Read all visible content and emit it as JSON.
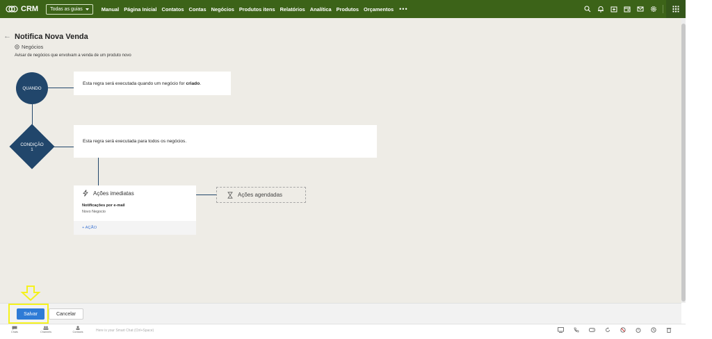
{
  "app": {
    "logo_text": "CRM",
    "guide_dropdown": "Todas as guias"
  },
  "nav": {
    "items": [
      "Manual",
      "Página Inicial",
      "Contatos",
      "Contas",
      "Negócios",
      "Produtos itens",
      "Relatórios",
      "Analítica",
      "Produtos",
      "Orçamentos"
    ],
    "more": "•••"
  },
  "rule": {
    "title": "Notifica Nova Venda",
    "module": "Negócios",
    "description": "Avisar de negócios que envolvam a venda de um produto novo"
  },
  "flow": {
    "when_label": "QUANDO",
    "when_text_pre": "Esta regra será executada quando um negócio for ",
    "when_text_bold": "criado",
    "when_text_post": ".",
    "condition_label": "CONDIÇÃO",
    "condition_number": "1",
    "condition_text": "Esta regra será executada para todos os negócios.",
    "immediate_title": "Ações imediatas",
    "immediate_item_title": "Notificações por e-mail",
    "immediate_item_sub": "Novo Negocio",
    "add_action": "+ AÇÃO",
    "scheduled_title": "Ações agendadas"
  },
  "footer": {
    "save": "Salvar",
    "cancel": "Cancelar"
  },
  "chatbar": {
    "items": [
      "Chats",
      "Channels",
      "Contacts"
    ],
    "placeholder": "Here is your Smart Chat (Ctrl+Space)"
  },
  "colors": {
    "topbar": "#3c6318",
    "node": "#21466b",
    "primary": "#2e7bd6",
    "highlight": "#f5f21c"
  },
  "icons": [
    "search-icon",
    "bell-icon",
    "calendar-add-icon",
    "calendar-icon",
    "mail-icon",
    "gear-icon",
    "apps-grid-icon"
  ]
}
